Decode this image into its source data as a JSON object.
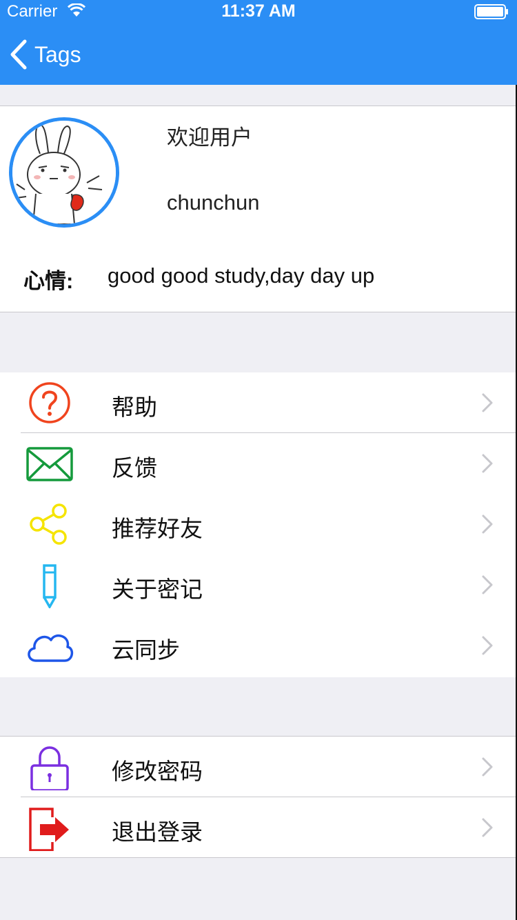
{
  "status_bar": {
    "carrier": "Carrier",
    "time": "11:37 AM"
  },
  "nav": {
    "back_label": "Tags"
  },
  "profile": {
    "welcome": "欢迎用户",
    "username": "chunchun",
    "mood_label": "心情:",
    "mood_text": "good good study,day day up"
  },
  "menu_group_1": [
    {
      "label": "帮助",
      "icon": "help-icon",
      "color": "#f0441e"
    },
    {
      "label": "反馈",
      "icon": "mail-icon",
      "color": "#159a3c"
    },
    {
      "label": "推荐好友",
      "icon": "share-icon",
      "color": "#f5e400"
    },
    {
      "label": "关于密记",
      "icon": "pen-icon",
      "color": "#25b7f0"
    },
    {
      "label": "云同步",
      "icon": "cloud-icon",
      "color": "#1e56e8"
    }
  ],
  "menu_group_2": [
    {
      "label": "修改密码",
      "icon": "lock-icon",
      "color": "#7b2fe0"
    },
    {
      "label": "退出登录",
      "icon": "logout-icon",
      "color": "#e01c1c"
    }
  ],
  "colors": {
    "nav_background": "#2b8ef5",
    "page_background": "#efeff4"
  }
}
